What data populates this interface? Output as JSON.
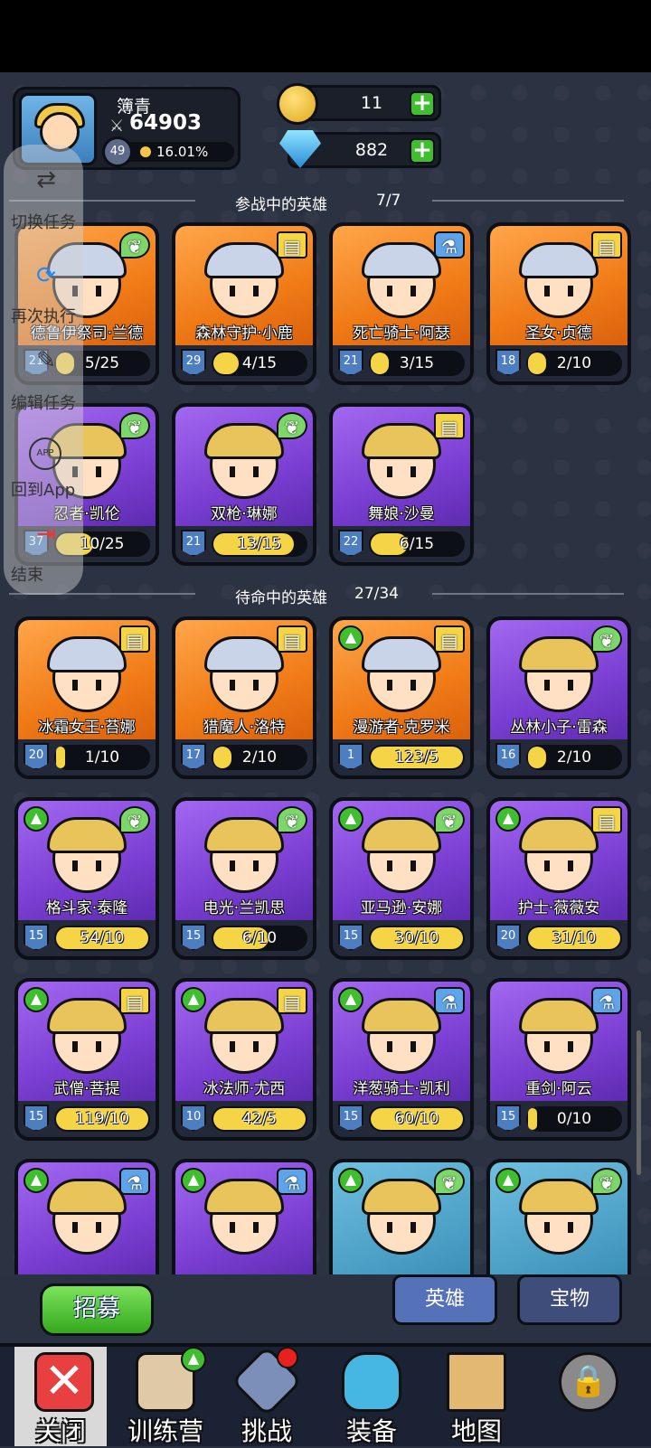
{
  "player": {
    "name": "簿青",
    "power": "64903",
    "level": "49",
    "xp_percent": "16.01%"
  },
  "resources": {
    "gold": "11",
    "gems": "882"
  },
  "sections": {
    "active_title": "参战中的英雄",
    "active_count": "7/7",
    "standby_title": "待命中的英雄",
    "standby_count": "27/34"
  },
  "overlay": {
    "switch": "切换任务",
    "rerun": "再次执行",
    "edit": "编辑任务",
    "app_badge": "APP",
    "back": "回到App",
    "end": "结束"
  },
  "active_heroes": [
    {
      "name": "德鲁伊祭司·兰德",
      "level": "21",
      "fragments": "5/25",
      "progress": 0.2,
      "color": "orange",
      "class_icon": "wing-icon"
    },
    {
      "name": "森林守护·小鹿",
      "level": "29",
      "fragments": "4/15",
      "progress": 0.27,
      "color": "orange",
      "class_icon": "book-icon"
    },
    {
      "name": "死亡骑士·阿瑟",
      "level": "21",
      "fragments": "3/15",
      "progress": 0.2,
      "color": "orange",
      "class_icon": "potion-icon"
    },
    {
      "name": "圣女·贞德",
      "level": "18",
      "fragments": "2/10",
      "progress": 0.2,
      "color": "orange",
      "class_icon": "book-icon"
    },
    {
      "name": "忍者·凯伦",
      "level": "37",
      "fragments": "10/25",
      "progress": 0.4,
      "color": "purple",
      "class_icon": "wing-icon"
    },
    {
      "name": "双枪·琳娜",
      "level": "21",
      "fragments": "13/15",
      "progress": 0.87,
      "color": "purple",
      "class_icon": "wing-icon"
    },
    {
      "name": "舞娘·沙曼",
      "level": "22",
      "fragments": "6/15",
      "progress": 0.4,
      "color": "purple",
      "class_icon": "book-icon"
    }
  ],
  "standby_heroes": [
    {
      "name": "冰霜女王·苔娜",
      "level": "20",
      "fragments": "1/10",
      "progress": 0.1,
      "color": "orange",
      "class_icon": "book-icon",
      "upgrade": false
    },
    {
      "name": "猎魔人·洛特",
      "level": "17",
      "fragments": "2/10",
      "progress": 0.2,
      "color": "orange",
      "class_icon": "book-icon",
      "upgrade": false
    },
    {
      "name": "漫游者·克罗米",
      "level": "1",
      "fragments": "123/5",
      "progress": 1,
      "color": "orange",
      "class_icon": "book-icon",
      "upgrade": true
    },
    {
      "name": "丛林小子·雷森",
      "level": "16",
      "fragments": "2/10",
      "progress": 0.2,
      "color": "purple",
      "class_icon": "wing-icon",
      "upgrade": false
    },
    {
      "name": "格斗家·泰隆",
      "level": "15",
      "fragments": "54/10",
      "progress": 1,
      "color": "purple",
      "class_icon": "wing-icon",
      "upgrade": true
    },
    {
      "name": "电光·兰凯思",
      "level": "15",
      "fragments": "6/10",
      "progress": 0.6,
      "color": "purple",
      "class_icon": "wing-icon",
      "upgrade": false
    },
    {
      "name": "亚马逊·安娜",
      "level": "15",
      "fragments": "30/10",
      "progress": 1,
      "color": "purple",
      "class_icon": "wing-icon",
      "upgrade": true
    },
    {
      "name": "护士·薇薇安",
      "level": "20",
      "fragments": "31/10",
      "progress": 1,
      "color": "purple",
      "class_icon": "book-icon",
      "upgrade": true
    },
    {
      "name": "武僧·菩提",
      "level": "15",
      "fragments": "119/10",
      "progress": 1,
      "color": "purple",
      "class_icon": "book-icon",
      "upgrade": true
    },
    {
      "name": "冰法师·尤西",
      "level": "10",
      "fragments": "42/5",
      "progress": 1,
      "color": "purple",
      "class_icon": "book-icon",
      "upgrade": true
    },
    {
      "name": "洋葱骑士·凯利",
      "level": "15",
      "fragments": "60/10",
      "progress": 1,
      "color": "purple",
      "class_icon": "potion-icon",
      "upgrade": true
    },
    {
      "name": "重剑·阿云",
      "level": "15",
      "fragments": "0/10",
      "progress": 0,
      "color": "purple",
      "class_icon": "potion-icon",
      "upgrade": false
    },
    {
      "name": "",
      "level": "",
      "fragments": "",
      "progress": 0,
      "color": "purple",
      "class_icon": "potion-icon",
      "upgrade": true
    },
    {
      "name": "",
      "level": "",
      "fragments": "",
      "progress": 0,
      "color": "purple",
      "class_icon": "potion-icon",
      "upgrade": true
    },
    {
      "name": "",
      "level": "",
      "fragments": "",
      "progress": 0,
      "color": "teal",
      "class_icon": "wing-icon",
      "upgrade": true
    },
    {
      "name": "",
      "level": "",
      "fragments": "",
      "progress": 0,
      "color": "teal",
      "class_icon": "wing-icon",
      "upgrade": true
    }
  ],
  "buttons": {
    "recruit": "招募",
    "tab_heroes": "英雄",
    "tab_treasure": "宝物"
  },
  "nav": [
    {
      "label": "关闭",
      "icon": "close-icon"
    },
    {
      "label": "训练营",
      "icon": "target-icon"
    },
    {
      "label": "挑战",
      "icon": "sword-icon"
    },
    {
      "label": "装备",
      "icon": "armor-icon"
    },
    {
      "label": "地图",
      "icon": "map-icon"
    },
    {
      "label": "",
      "icon": "locked-icon"
    }
  ],
  "colors": {
    "orange": "#f07b17",
    "purple": "#7b3fd3",
    "accent_green": "#3fbf2f",
    "gold": "#f5d445"
  }
}
